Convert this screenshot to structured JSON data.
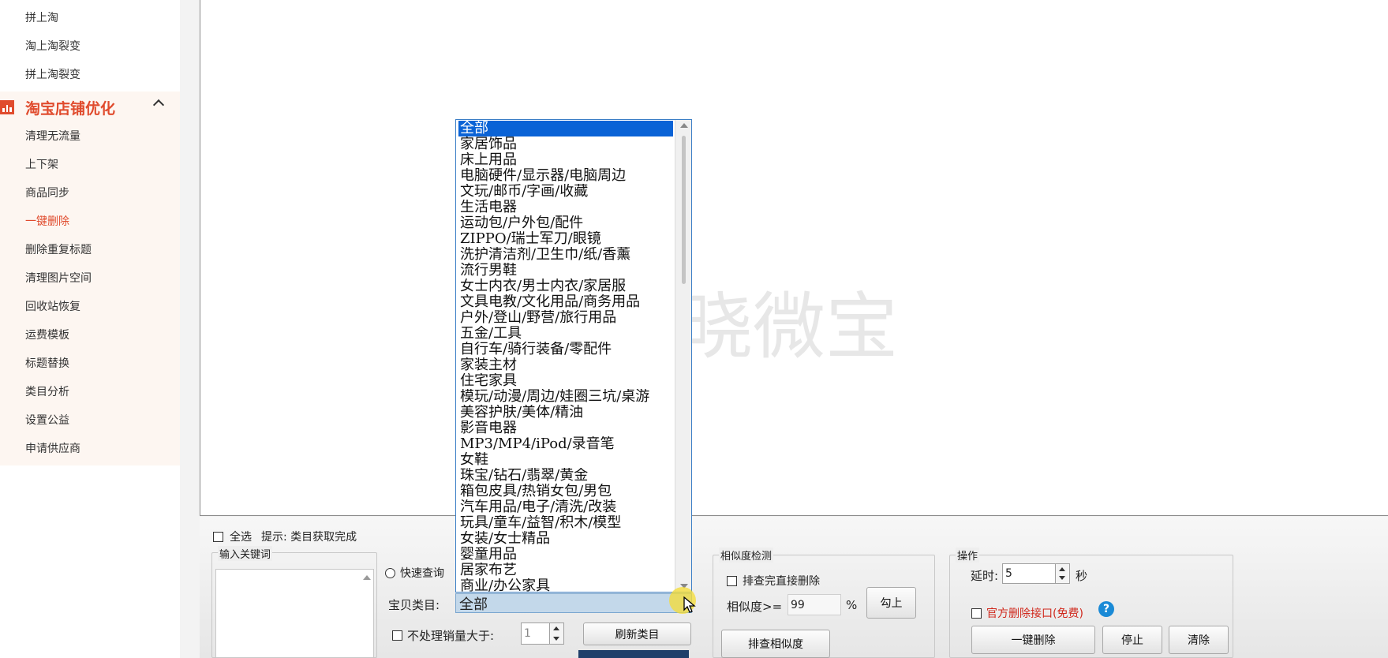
{
  "sidebar": {
    "top_items": [
      "拼上淘",
      "淘上淘裂变",
      "拼上淘裂变"
    ],
    "group_title": "淘宝店铺优化",
    "items": [
      "清理无流量",
      "上下架",
      "商品同步",
      "一键删除",
      "删除重复标题",
      "清理图片空间",
      "回收站恢复",
      "运费模板",
      "标题替换",
      "类目分析",
      "设置公益",
      "申请供应商"
    ],
    "active_item": "一键删除",
    "accent_color": "#e04b2d"
  },
  "watermark": "晓微宝",
  "dropdown": {
    "selected": "全部",
    "options": [
      "全部",
      "家居饰品",
      "床上用品",
      "电脑硬件/显示器/电脑周边",
      "文玩/邮币/字画/收藏",
      "生活电器",
      "运动包/户外包/配件",
      "ZIPPO/瑞士军刀/眼镜",
      "洗护清洁剂/卫生巾/纸/香薰",
      "流行男鞋",
      "女士内衣/男士内衣/家居服",
      "文具电教/文化用品/商务用品",
      "户外/登山/野营/旅行用品",
      "五金/工具",
      "自行车/骑行装备/零配件",
      "家装主材",
      "住宅家具",
      "模玩/动漫/周边/娃圈三坑/桌游",
      "美容护肤/美体/精油",
      "影音电器",
      "MP3/MP4/iPod/录音笔",
      "女鞋",
      "珠宝/钻石/翡翠/黄金",
      "箱包皮具/热销女包/男包",
      "汽车用品/电子/清洗/改装",
      "玩具/童车/益智/积木/模型",
      "女装/女士精品",
      "婴童用品",
      "居家布艺",
      "商业/办公家具"
    ]
  },
  "bottom": {
    "select_all_label": "全选",
    "hint": "提示: 类目获取完成",
    "keyword_group_title": "输入关键词",
    "quick_query_label": "快速查询",
    "category_label": "宝贝类目:",
    "category_value": "全部",
    "sales_label": "不处理销量大于:",
    "sales_value": "1",
    "refresh_button": "刷新类目",
    "similarity_group_title": "相似度检测",
    "delete_after_check_label": "排查完直接删除",
    "similarity_label": "相似度>=",
    "similarity_value": "99",
    "percent": "%",
    "check_button": "勾上",
    "check_similarity_button": "排查相似度",
    "operation_group_title": "操作",
    "delay_label": "延时:",
    "delay_value": "5",
    "delay_unit": "秒",
    "official_api_label": "官方删除接口(免费)",
    "official_api_color": "#d0281c",
    "delete_button": "一键删除",
    "stop_button": "停止",
    "clear_button": "清除"
  }
}
